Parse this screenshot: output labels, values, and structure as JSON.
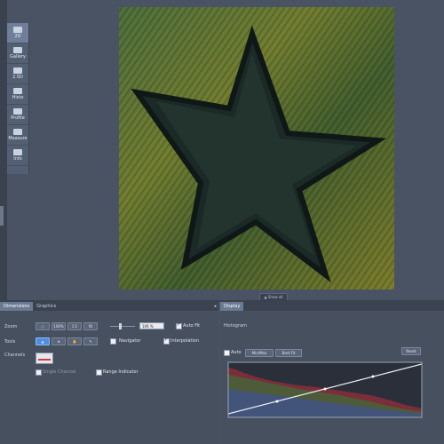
{
  "view_tabs": [
    {
      "label": "2D",
      "active": true
    },
    {
      "label": "Gallery",
      "active": false
    },
    {
      "label": "2.5D",
      "active": false
    },
    {
      "label": "Histo",
      "active": false
    },
    {
      "label": "Profile",
      "active": false
    },
    {
      "label": "Measure",
      "active": false
    },
    {
      "label": "Info",
      "active": false
    }
  ],
  "image": {
    "subject": "star"
  },
  "collapse_label": "▲ Show all",
  "left_panel": {
    "tabs": [
      "Dimensions",
      "Graphics"
    ],
    "zoom_label": "Zoom",
    "zoom_buttons": [
      "○",
      "100%",
      "1:1",
      "fit"
    ],
    "zoom_value": "106 %",
    "auto_fit_label": "Auto Fit",
    "tools_label": "Tools",
    "navigator_label": "Navigator",
    "interpolation_label": "Interpolation",
    "channels_label": "Channels",
    "single_channel_label": "Single Channel",
    "range_indicator_label": "Range Indicator"
  },
  "right_panel": {
    "tab": "Display",
    "histogram_title": "Histogram",
    "auto_label": "Auto",
    "minmax_label": "Min/Max",
    "bestfit_label": "Best Fit",
    "reset_label": "Reset"
  },
  "colors": {
    "accent": "#4e8ee0",
    "background": "#4a5363",
    "panel": "#47505f"
  }
}
